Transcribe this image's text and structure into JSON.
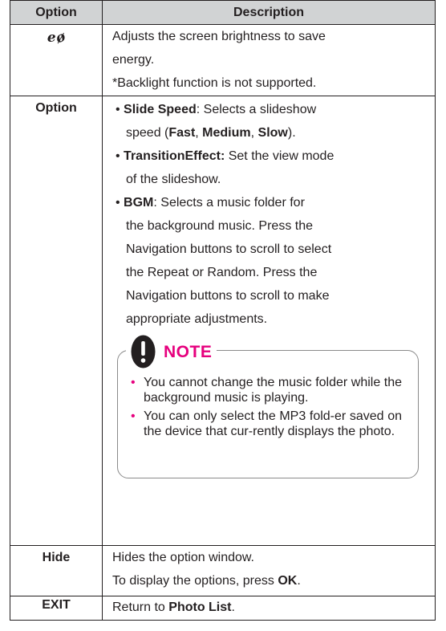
{
  "header": {
    "option": "Option",
    "description": "Description"
  },
  "rows": {
    "energy": {
      "desc_line1": "Adjusts the screen brightness to save",
      "desc_line2": "energy.",
      "desc_line3": "*Backlight function is not supported."
    },
    "option": {
      "key": "Option",
      "slide_speed_label": "Slide Speed",
      "slide_speed_text": ": Selects a slideshow",
      "slide_speed_cont_pre": "speed (",
      "fast": "Fast",
      "medium": "Medium",
      "slow": "Slow",
      "slide_speed_cont_post": ").",
      "transition_label": "TransitionEffect:",
      "transition_text": " Set the view mode",
      "transition_cont": "of the slideshow.",
      "bgm_label": "BGM",
      "bgm_text": ": Selects a music folder for",
      "bgm_cont": [
        "the background music. Press the",
        "Navigation buttons to scroll to select",
        "the Repeat or Random. Press the",
        "Navigation buttons to scroll to make",
        "appropriate adjustments."
      ],
      "note": {
        "title": "NOTE",
        "items": [
          "You cannot change the music folder while the background music is playing.",
          "You can only select the MP3 fold-er saved on the device that cur-rently displays the photo."
        ]
      }
    },
    "hide": {
      "key": "Hide",
      "desc_line1": "Hides the option window.",
      "desc_line2_pre": "To display the options, press ",
      "desc_line2_bold": "OK",
      "desc_line2_post": "."
    },
    "exit": {
      "key": "EXIT",
      "desc_pre": "Return to ",
      "desc_bold": "Photo List",
      "desc_post": "."
    }
  },
  "colors": {
    "header_bg": "#d1d3d4",
    "accent": "#e6007e",
    "text": "#231f20"
  },
  "icons": {
    "energy_key": "energy-saving-icon",
    "note": "warning-icon"
  }
}
